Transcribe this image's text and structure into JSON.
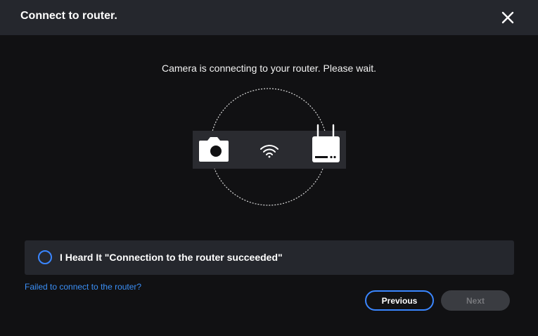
{
  "dialog": {
    "title": "Connect to router.",
    "close_icon": "close-icon"
  },
  "status_message": "Camera is connecting to your router. Please wait.",
  "illustration": {
    "icons": [
      "camera-icon",
      "wifi-icon",
      "router-icon"
    ]
  },
  "confirm": {
    "label": "I Heard It \"Connection to the router succeeded\"",
    "checked": false
  },
  "help_link": "Failed to connect to the router?",
  "buttons": {
    "previous": "Previous",
    "next": "Next",
    "next_enabled": false
  },
  "colors": {
    "accent": "#3a86ff",
    "link": "#3b8ff6",
    "header_bg": "#25272d",
    "body_bg": "#111113"
  }
}
